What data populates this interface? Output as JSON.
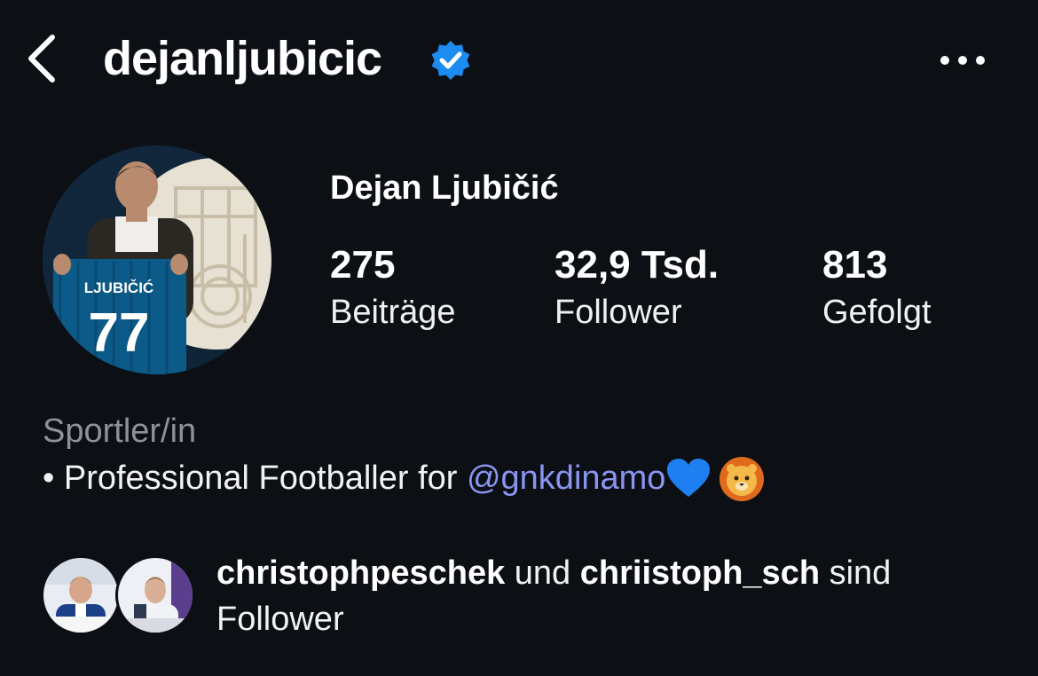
{
  "header": {
    "username": "dejanljubicic",
    "back_icon": "chevron-left-icon",
    "verified_icon": "verified-badge-icon",
    "more_icon": "more-horizontal-icon"
  },
  "profile": {
    "display_name": "Dejan Ljubičić",
    "avatar_jersey_name": "LJUBIČIĆ",
    "avatar_jersey_number": "77",
    "stats": [
      {
        "value": "275",
        "label": "Beiträge"
      },
      {
        "value": "32,9 Tsd.",
        "label": "Follower"
      },
      {
        "value": "813",
        "label": "Gefolgt"
      }
    ],
    "category": "Sportler/in",
    "bio": {
      "prefix": "• Professional Footballer for ",
      "mention": "@gnkdinamo",
      "emojis": [
        "blue-heart",
        "lion-face"
      ]
    }
  },
  "followed_by": {
    "user1": "christophpeschek",
    "connector": " und ",
    "user2": "chriistoph_sch",
    "suffix_line1": " sind",
    "suffix_line2": "Follower"
  },
  "colors": {
    "background": "#0c0f14",
    "verified": "#1d8cf0",
    "mention": "#8a95f2",
    "muted": "#8e9196"
  }
}
